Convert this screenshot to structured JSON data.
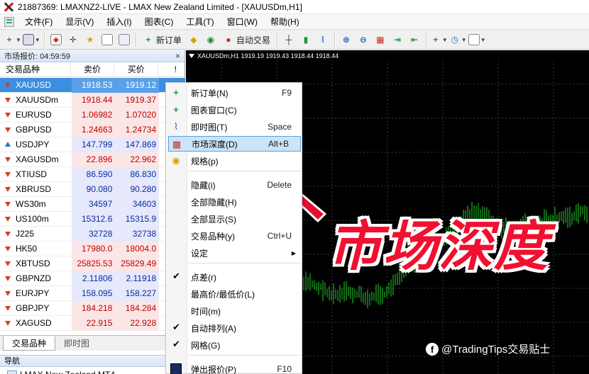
{
  "window": {
    "title": "21887369: LMAXNZ2-LIVE - LMAX New Zealand Limited - [XAUUSDm,H1]"
  },
  "menu": [
    "文件(F)",
    "显示(V)",
    "插入(I)",
    "图表(C)",
    "工具(T)",
    "窗口(W)",
    "帮助(H)"
  ],
  "toolbar": {
    "new_order": "新订单",
    "autotrade": "自动交易"
  },
  "market_watch": {
    "header": "市场报价: 04:59:59",
    "columns": {
      "symbol": "交易品种",
      "bid": "卖价",
      "ask": "买价",
      "extra": "!"
    },
    "rows": [
      {
        "symbol": "XAUUSD",
        "bid": "1918.53",
        "ask": "1919.12",
        "dir": "down",
        "color": "sel"
      },
      {
        "symbol": "XAUUSDm",
        "bid": "1918.44",
        "ask": "1919.37",
        "dir": "down",
        "color": "red"
      },
      {
        "symbol": "EURUSD",
        "bid": "1.06982",
        "ask": "1.07020",
        "dir": "down",
        "color": "red"
      },
      {
        "symbol": "GBPUSD",
        "bid": "1.24663",
        "ask": "1.24734",
        "dir": "down",
        "color": "red"
      },
      {
        "symbol": "USDJPY",
        "bid": "147.799",
        "ask": "147.869",
        "dir": "up",
        "color": "blue"
      },
      {
        "symbol": "XAGUSDm",
        "bid": "22.896",
        "ask": "22.962",
        "dir": "down",
        "color": "red"
      },
      {
        "symbol": "XTIUSD",
        "bid": "86.590",
        "ask": "86.830",
        "dir": "down",
        "color": "blue"
      },
      {
        "symbol": "XBRUSD",
        "bid": "90.080",
        "ask": "90.280",
        "dir": "down",
        "color": "blue"
      },
      {
        "symbol": "WS30m",
        "bid": "34597",
        "ask": "34603",
        "dir": "down",
        "color": "blue"
      },
      {
        "symbol": "US100m",
        "bid": "15312.6",
        "ask": "15315.9",
        "dir": "down",
        "color": "blue"
      },
      {
        "symbol": "J225",
        "bid": "32728",
        "ask": "32738",
        "dir": "down",
        "color": "blue"
      },
      {
        "symbol": "HK50",
        "bid": "17980.0",
        "ask": "18004.0",
        "dir": "down",
        "color": "red"
      },
      {
        "symbol": "XBTUSD",
        "bid": "25825.53",
        "ask": "25829.49",
        "dir": "down",
        "color": "red"
      },
      {
        "symbol": "GBPNZD",
        "bid": "2.11806",
        "ask": "2.11918",
        "dir": "down",
        "color": "blue"
      },
      {
        "symbol": "EURJPY",
        "bid": "158.095",
        "ask": "158.227",
        "dir": "down",
        "color": "blue"
      },
      {
        "symbol": "GBPJPY",
        "bid": "184.218",
        "ask": "184.284",
        "dir": "down",
        "color": "red"
      },
      {
        "symbol": "XAGUSD",
        "bid": "22.915",
        "ask": "22.928",
        "dir": "down",
        "color": "red"
      }
    ],
    "tabs": [
      "交易品种",
      "即时图"
    ]
  },
  "navigator": {
    "header": "导航",
    "item": "LMAX New Zealand MT4"
  },
  "chart": {
    "title": "XAUUSDm,H1  1919.19 1919.43 1918.44 1918.44"
  },
  "context_menu": {
    "items": [
      {
        "label": "新订单(N)",
        "shortcut": "F9",
        "icon": "new-order-icon"
      },
      {
        "label": "图表窗口(C)",
        "shortcut": "",
        "icon": "chart-window-icon"
      },
      {
        "label": "即时图(T)",
        "shortcut": "Space",
        "icon": "tick-chart-icon"
      },
      {
        "label": "市场深度(D)",
        "shortcut": "Alt+B",
        "icon": "market-depth-icon"
      },
      {
        "label": "规格(p)",
        "shortcut": "",
        "icon": "specification-icon"
      },
      {
        "label": "隐藏(i)",
        "shortcut": "Delete"
      },
      {
        "label": "全部隐藏(H)",
        "shortcut": ""
      },
      {
        "label": "全部显示(S)",
        "shortcut": ""
      },
      {
        "label": "交易品种(y)",
        "shortcut": "Ctrl+U"
      },
      {
        "label": "设定",
        "shortcut": ""
      },
      {
        "label": "点差(r)",
        "shortcut": ""
      },
      {
        "label": "最高价/最低价(L)",
        "shortcut": ""
      },
      {
        "label": "时间(m)",
        "shortcut": ""
      },
      {
        "label": "自动排列(A)",
        "shortcut": ""
      },
      {
        "label": "网格(G)",
        "shortcut": ""
      },
      {
        "label": "弹出报价(P)",
        "shortcut": "F10"
      }
    ]
  },
  "overlay": {
    "caption": "市场深度",
    "watermark": "@TradingTips交易贴士",
    "caption_color": "#f01030"
  }
}
